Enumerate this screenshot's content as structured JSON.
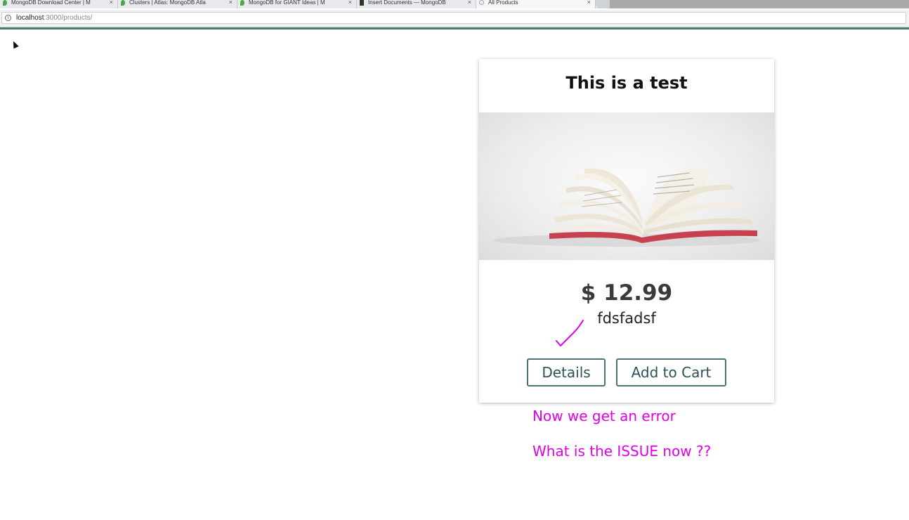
{
  "browser": {
    "tabs": [
      {
        "title": "MongoDB Download Center | M",
        "icon": "leaf-icon",
        "active": false
      },
      {
        "title": "Clusters | Atlas: MongoDB Atla",
        "icon": "leaf-icon",
        "active": false
      },
      {
        "title": "MongoDB for GIANT Ideas | M",
        "icon": "leaf-icon",
        "active": false
      },
      {
        "title": "Insert Documents — MongoDB",
        "icon": "doc-icon",
        "active": false
      },
      {
        "title": "All Products",
        "icon": "loading-icon",
        "active": true
      }
    ],
    "tab_close_glyph": "×",
    "address": {
      "host": "localhost",
      "rest": ":3000/products/"
    }
  },
  "product": {
    "title": "This is a test",
    "price": "$ 12.99",
    "description": "fdsfadsf",
    "details_label": "Details",
    "add_to_cart_label": "Add to Cart"
  },
  "annotations": {
    "color": "#e100e8",
    "line1": "Now we get an error",
    "line2": "What is the ISSUE now ??"
  },
  "colors": {
    "button_border": "#4a7378",
    "button_text": "#2b5257",
    "load_bar": "#4f7d72"
  }
}
